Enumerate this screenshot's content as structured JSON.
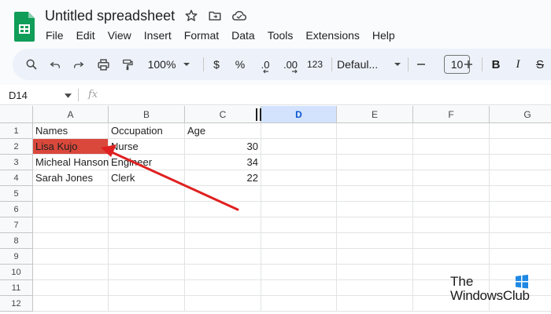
{
  "document": {
    "title": "Untitled spreadsheet"
  },
  "menu": [
    "File",
    "Edit",
    "View",
    "Insert",
    "Format",
    "Data",
    "Tools",
    "Extensions",
    "Help"
  ],
  "toolbar": {
    "zoom": "100%",
    "currency": "$",
    "percent": "%",
    "decrease_decimal": ".0",
    "increase_decimal": ".00",
    "number_format": "123",
    "font_family": "Defaul...",
    "font_size": "10",
    "bold": "B",
    "italic": "I"
  },
  "formula_bar": {
    "cell_ref": "D14",
    "fx": "fx"
  },
  "grid": {
    "columns": [
      "A",
      "B",
      "C",
      "D",
      "E",
      "F",
      "G"
    ],
    "selected_column": "D",
    "rows": [
      "1",
      "2",
      "3",
      "4",
      "5",
      "6",
      "7",
      "8",
      "9",
      "10",
      "11",
      "12"
    ],
    "cells": [
      [
        "Names",
        "Occupation",
        "Age"
      ],
      [
        "Lisa Kujo",
        "Nurse",
        "30"
      ],
      [
        "Micheal Hanson",
        "Engineer",
        "34"
      ],
      [
        "Sarah Jones",
        "Clerk",
        "22"
      ]
    ],
    "highlighted_cell": "A2",
    "highlight_color": "#d9483b"
  },
  "annotation": {
    "arrow_color": "#e02020"
  },
  "watermark": {
    "line1": "The",
    "line2": "WindowsClub"
  },
  "icons": [
    "sheets-logo-icon",
    "star-icon",
    "move-folder-icon",
    "cloud-status-icon",
    "search-icon",
    "undo-icon",
    "redo-icon",
    "print-icon",
    "paint-format-icon",
    "chevron-down-icon",
    "minus-icon",
    "plus-icon"
  ]
}
